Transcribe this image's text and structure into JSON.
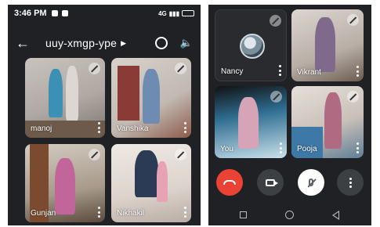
{
  "status_bar": {
    "time": "3:46 PM",
    "network": "4G"
  },
  "meeting": {
    "code": "uuy-xmgp-ype"
  },
  "left_grid": [
    {
      "name": "manoj"
    },
    {
      "name": "Vanshika"
    },
    {
      "name": "Gunjan"
    },
    {
      "name": "Nikhakil"
    }
  ],
  "right_grid": [
    {
      "name": "Nancy"
    },
    {
      "name": "Vikrant"
    },
    {
      "name": "You"
    },
    {
      "name": "Pooja"
    }
  ],
  "icons": {
    "back": "arrow-left-icon",
    "caret": "caret-right-icon",
    "switch_camera": "switch-camera-icon",
    "speaker": "speaker-icon",
    "muted": "mic-off-icon"
  },
  "colors": {
    "end_call": "#ea4335",
    "background": "#202124"
  }
}
